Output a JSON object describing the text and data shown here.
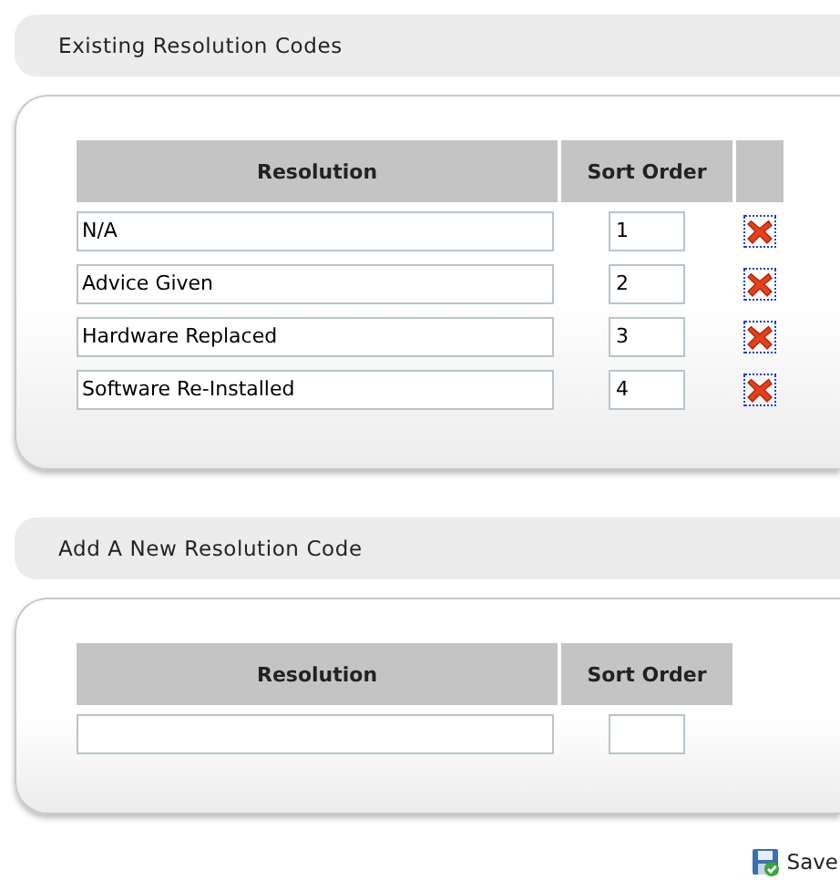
{
  "sections": [
    {
      "title": "Existing Resolution Codes",
      "columns": [
        "Resolution",
        "Sort Order"
      ],
      "delete_column": true,
      "rows": [
        {
          "resolution": "N/A",
          "sort_order": "1"
        },
        {
          "resolution": "Advice Given",
          "sort_order": "2"
        },
        {
          "resolution": "Hardware Replaced",
          "sort_order": "3"
        },
        {
          "resolution": "Software Re-Installed",
          "sort_order": "4"
        }
      ]
    },
    {
      "title": "Add A New Resolution Code",
      "columns": [
        "Resolution",
        "Sort Order"
      ],
      "delete_column": false,
      "rows": [
        {
          "resolution": "",
          "sort_order": ""
        }
      ]
    }
  ],
  "save_button": {
    "label": "Save"
  }
}
